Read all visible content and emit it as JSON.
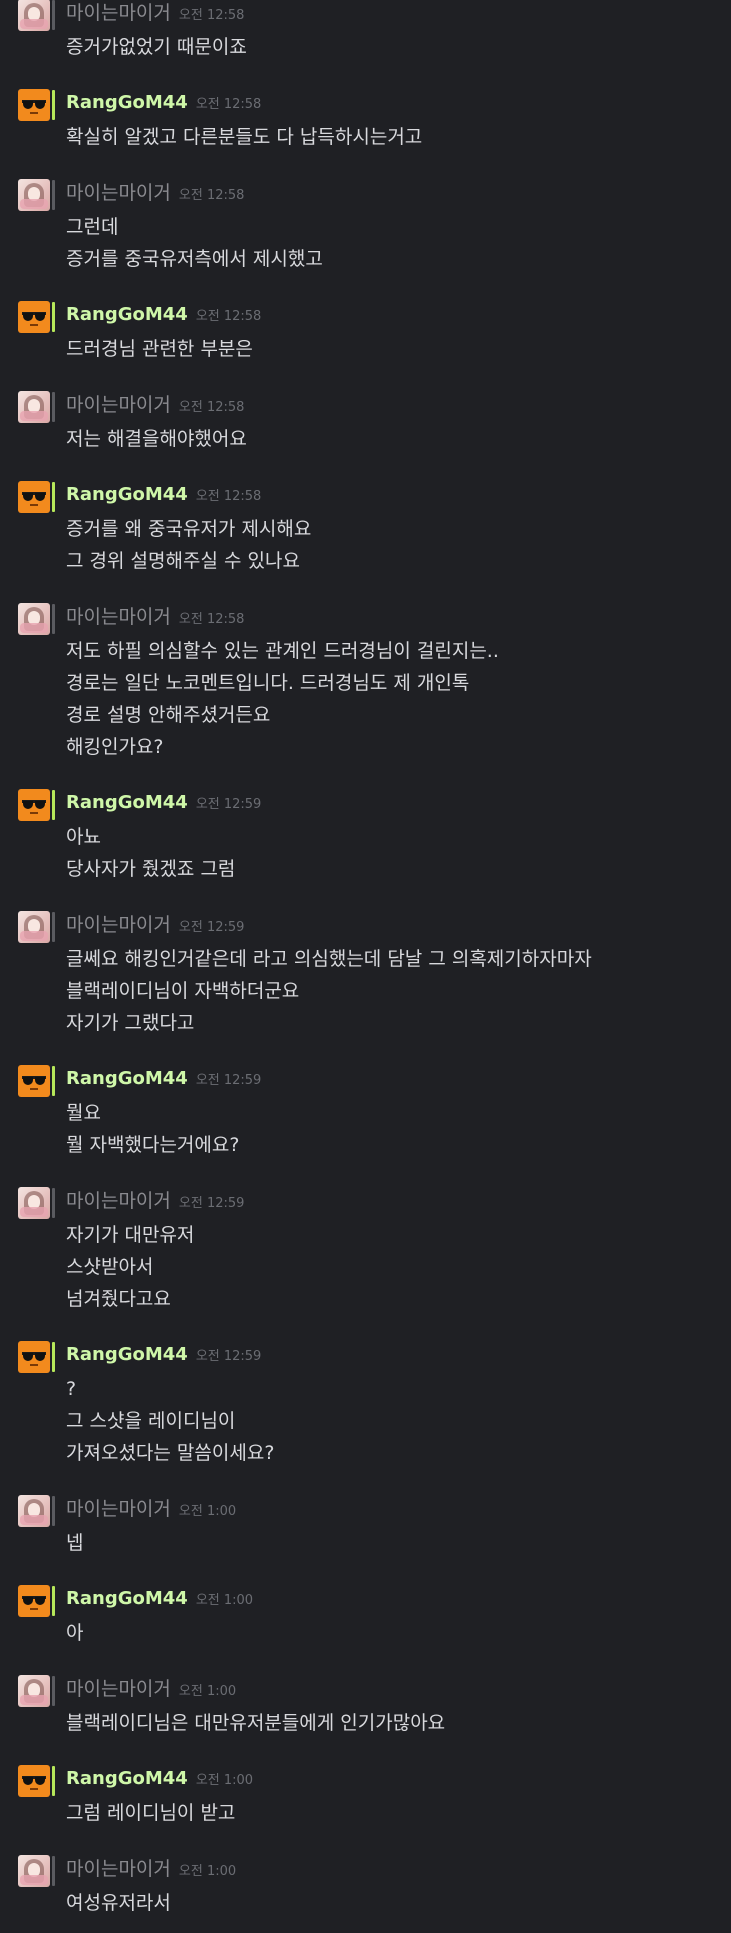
{
  "messages": [
    {
      "user": "마이는마이거",
      "time": "오전 12:58",
      "avatar": "girl-photo-avatar",
      "lines": [
        "증거가없었기 때문이죠"
      ]
    },
    {
      "user": "RangGoM44",
      "time": "오전 12:58",
      "avatar": "sunglasses-avatar",
      "lines": [
        "확실히 알겠고 다른분들도 다 납득하시는거고"
      ]
    },
    {
      "user": "마이는마이거",
      "time": "오전 12:58",
      "avatar": "girl-photo-avatar",
      "lines": [
        "그런데",
        "증거를 중국유저측에서 제시했고"
      ]
    },
    {
      "user": "RangGoM44",
      "time": "오전 12:58",
      "avatar": "sunglasses-avatar",
      "lines": [
        "드러경님 관련한 부분은"
      ]
    },
    {
      "user": "마이는마이거",
      "time": "오전 12:58",
      "avatar": "girl-photo-avatar",
      "lines": [
        "저는 해결을해야했어요"
      ]
    },
    {
      "user": "RangGoM44",
      "time": "오전 12:58",
      "avatar": "sunglasses-avatar",
      "lines": [
        "증거를 왜 중국유저가 제시해요",
        "그 경위 설명해주실 수 있나요"
      ]
    },
    {
      "user": "마이는마이거",
      "time": "오전 12:58",
      "avatar": "girl-photo-avatar",
      "lines": [
        "저도 하필 의심할수 있는 관계인 드러경님이 걸린지는..",
        "경로는 일단 노코멘트입니다. 드러경님도 제 개인톡",
        "경로 설명 안해주셨거든요",
        "해킹인가요?"
      ]
    },
    {
      "user": "RangGoM44",
      "time": "오전 12:59",
      "avatar": "sunglasses-avatar",
      "lines": [
        "아뇨",
        "당사자가 줬겠죠 그럼"
      ]
    },
    {
      "user": "마이는마이거",
      "time": "오전 12:59",
      "avatar": "girl-photo-avatar",
      "lines": [
        "글쎄요 해킹인거같은데 라고 의심했는데 담날 그 의혹제기하자마자",
        "블랙레이디님이 자백하더군요",
        "자기가 그랬다고"
      ]
    },
    {
      "user": "RangGoM44",
      "time": "오전 12:59",
      "avatar": "sunglasses-avatar",
      "lines": [
        "뭘요",
        "뭘 자백했다는거에요?"
      ]
    },
    {
      "user": "마이는마이거",
      "time": "오전 12:59",
      "avatar": "girl-photo-avatar",
      "lines": [
        "자기가 대만유저",
        "스샷받아서",
        "넘겨줬다고요"
      ]
    },
    {
      "user": "RangGoM44",
      "time": "오전 12:59",
      "avatar": "sunglasses-avatar",
      "lines": [
        "?",
        "그 스샷을 레이디님이",
        "가져오셨다는 말씀이세요?"
      ]
    },
    {
      "user": "마이는마이거",
      "time": "오전 1:00",
      "avatar": "girl-photo-avatar",
      "lines": [
        "넵"
      ]
    },
    {
      "user": "RangGoM44",
      "time": "오전 1:00",
      "avatar": "sunglasses-avatar",
      "lines": [
        "아"
      ]
    },
    {
      "user": "마이는마이거",
      "time": "오전 1:00",
      "avatar": "girl-photo-avatar",
      "lines": [
        "블랙레이디님은 대만유저분들에게 인기가많아요"
      ]
    },
    {
      "user": "RangGoM44",
      "time": "오전 1:00",
      "avatar": "sunglasses-avatar",
      "lines": [
        "그럼 레이디님이 받고"
      ]
    },
    {
      "user": "마이는마이거",
      "time": "오전 1:00",
      "avatar": "girl-photo-avatar",
      "lines": [
        "여성유저라서"
      ]
    }
  ],
  "colors": {
    "background": "#1f2024",
    "rang_name": "#cff7a9",
    "rang_bar": "#b6e85a",
    "mai_name": "#8a8a8f",
    "mai_bar": "#5a5b60",
    "time": "#6b6d73",
    "text": "#d8d9dd"
  }
}
